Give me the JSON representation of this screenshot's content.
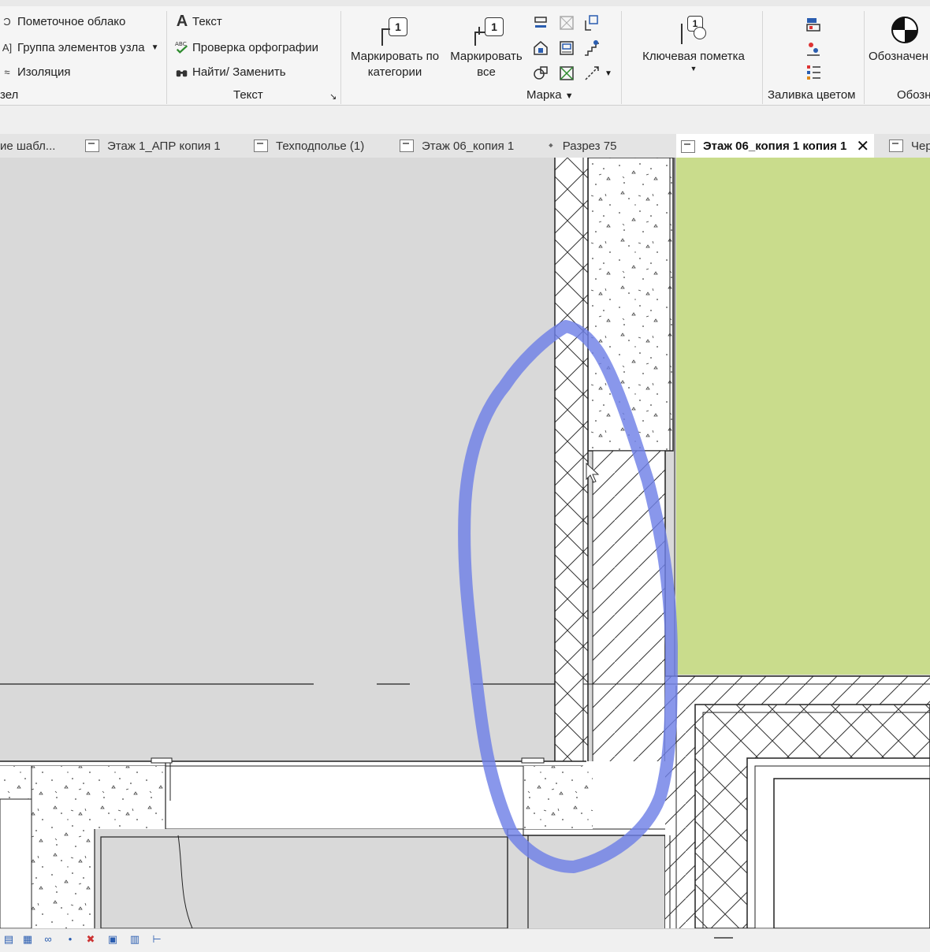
{
  "ribbon": {
    "annotation_group": {
      "items": [
        {
          "label": "Пометочное облако",
          "icon": "revision-cloud-icon"
        },
        {
          "label": "Группа элементов узла",
          "icon": "detail-group-icon"
        },
        {
          "label": "Изоляция",
          "icon": "insulation-icon"
        }
      ],
      "panel_title": "зел"
    },
    "text_panel": {
      "items": [
        {
          "label": "Текст",
          "icon": "text-A-icon"
        },
        {
          "label": "Проверка  орфографии",
          "icon": "spellcheck-icon",
          "icon_text": "ABC"
        },
        {
          "label": "Найти/ Заменить",
          "icon": "find-replace-icon"
        }
      ],
      "panel_title": "Текст"
    },
    "tag_panel": {
      "tag_by_category": {
        "line1": "Маркировать по",
        "line2": "категории",
        "number": "1"
      },
      "tag_all": {
        "line1": "Маркировать",
        "line2": "все",
        "number": "1"
      },
      "panel_title": "Марка"
    },
    "keynote": {
      "label": "Ключевая пометка",
      "number": "1"
    },
    "color_fill": {
      "panel_title": "Заливка цветом"
    },
    "symbol": {
      "label": "Обозначен",
      "panel_title": "Обозн"
    }
  },
  "tabs": [
    {
      "label": "ие шабл...",
      "icon": "view-icon"
    },
    {
      "label": "Этаж 1_АПР копия 1",
      "icon": "floor-plan-icon"
    },
    {
      "label": "Техподполье (1)",
      "icon": "floor-plan-icon"
    },
    {
      "label": "Этаж 06_копия 1",
      "icon": "floor-plan-icon"
    },
    {
      "label": "Разрез 75",
      "icon": "section-icon"
    },
    {
      "label": "Этаж 06_копия 1 копия 1",
      "icon": "floor-plan-icon",
      "active": true,
      "close": "✕"
    },
    {
      "label": "Чер",
      "icon": "floor-plan-icon"
    }
  ],
  "colors": {
    "green_fill": "#c9dc8c",
    "annotation_blue": "#6f80e6",
    "canvas_bg": "#d9d9d9"
  },
  "statusbar": {
    "icons": [
      "design-options-icon",
      "worksets-icon",
      "link-icon",
      "pin-icon",
      "filter-icon",
      "select-icon",
      "temp-hide-icon",
      "reveal-icon"
    ]
  }
}
